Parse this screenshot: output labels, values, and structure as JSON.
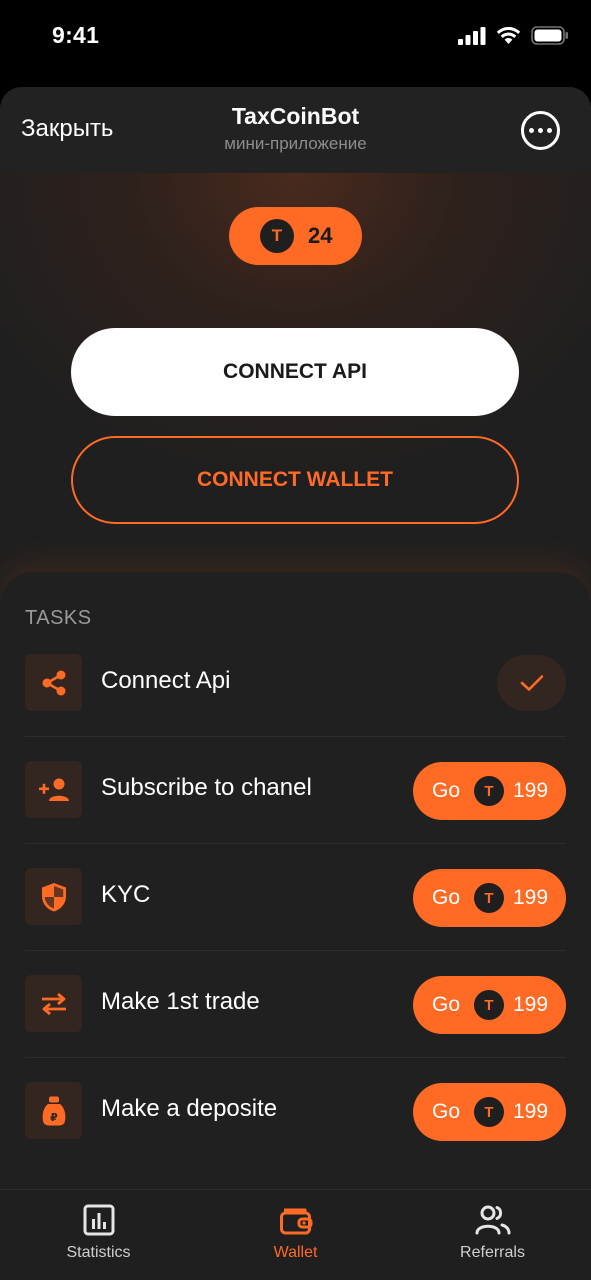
{
  "status_bar": {
    "time": "9:41"
  },
  "header": {
    "close_label": "Закрыть",
    "title": "TaxCoinBot",
    "subtitle": "мини-приложение"
  },
  "balance": {
    "coin_symbol": "T",
    "value": "24"
  },
  "buttons": {
    "connect_api": "CONNECT API",
    "connect_wallet": "CONNECT WALLET"
  },
  "tasks": {
    "heading": "TASKS",
    "items": [
      {
        "label": "Connect Api",
        "icon": "share-icon",
        "completed": true
      },
      {
        "label": "Subscribe to chanel",
        "icon": "add-person-icon",
        "action": "Go",
        "coin_symbol": "T",
        "reward": "199"
      },
      {
        "label": "KYC",
        "icon": "shield-icon",
        "action": "Go",
        "coin_symbol": "T",
        "reward": "199"
      },
      {
        "label": "Make 1st trade",
        "icon": "swap-arrows-icon",
        "action": "Go",
        "coin_symbol": "T",
        "reward": "199"
      },
      {
        "label": "Make a deposite",
        "icon": "money-bag-icon",
        "action": "Go",
        "coin_symbol": "T",
        "reward": "199"
      }
    ]
  },
  "nav": {
    "items": [
      {
        "label": "Statistics",
        "icon": "chart-icon",
        "active": false
      },
      {
        "label": "Wallet",
        "icon": "wallet-icon",
        "active": true
      },
      {
        "label": "Referrals",
        "icon": "people-icon",
        "active": false
      }
    ]
  },
  "colors": {
    "accent": "#ff6a25",
    "background": "#1f1f1f",
    "icon_tile": "#33251f"
  }
}
